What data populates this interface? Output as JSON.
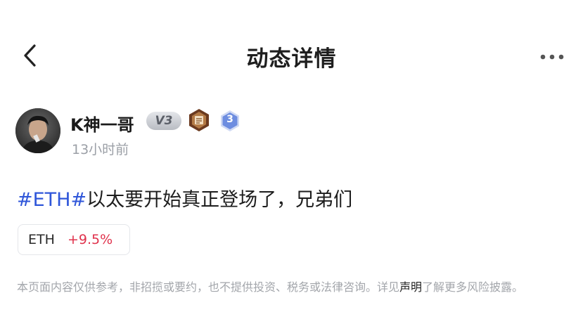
{
  "header": {
    "title": "动态详情",
    "back_icon": "chevron-left-icon",
    "more_icon": "more-horizontal-icon"
  },
  "author": {
    "name": "K神一哥",
    "level_badge": "V3",
    "rank": "3",
    "time": "13小时前",
    "medal_icon": "medal-icon"
  },
  "post": {
    "hashtag": "#ETH#",
    "text": "以太要开始真正登场了，兄弟们"
  },
  "ticker": {
    "symbol": "ETH",
    "change": "+9.5%",
    "change_color": "#e0324c"
  },
  "disclaimer": {
    "text_before": "本页面内容仅供参考，非招揽或要约，也不提供投资、税务或法律咨询。详见",
    "link": "声明",
    "text_after": "了解更多风险披露。"
  },
  "colors": {
    "accent": "#2f56d9",
    "positive": "#e0324c",
    "muted": "#a3a6ab"
  }
}
